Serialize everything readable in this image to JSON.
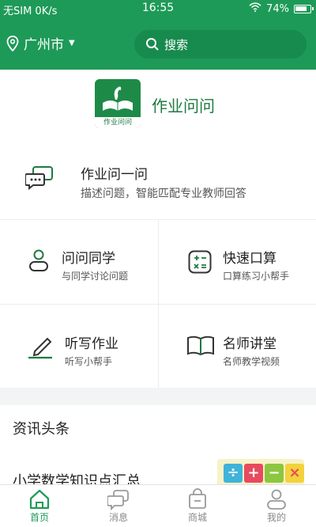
{
  "statusbar": {
    "carrier": "无SIM 0K/s",
    "time": "16:55",
    "battery": "74%"
  },
  "header": {
    "city": "广州市",
    "search_placeholder": "搜索"
  },
  "brand": {
    "name": "作业问问",
    "logo_caption": "作业问问"
  },
  "ask": {
    "title": "作业问一问",
    "subtitle": "描述问题，智能匹配专业教师回答"
  },
  "features": [
    {
      "title": "问问同学",
      "subtitle": "与同学讨论问题",
      "icon": "user-icon"
    },
    {
      "title": "快速口算",
      "subtitle": "口算练习小帮手",
      "icon": "calculator-icon"
    },
    {
      "title": "听写作业",
      "subtitle": "听写小帮手",
      "icon": "pen-icon"
    },
    {
      "title": "名师讲堂",
      "subtitle": "名师教学视频",
      "icon": "book-icon"
    }
  ],
  "news": {
    "header": "资讯头条",
    "first_title": "小学数学知识点汇总"
  },
  "tabs": [
    {
      "label": "首页",
      "icon": "home-icon",
      "active": true
    },
    {
      "label": "消息",
      "icon": "message-icon",
      "active": false
    },
    {
      "label": "商城",
      "icon": "shop-icon",
      "active": false
    },
    {
      "label": "我的",
      "icon": "profile-icon",
      "active": false
    }
  ],
  "colors": {
    "primary": "#1e9a58",
    "brand_text": "#1e7a40",
    "tab_inactive": "#888888"
  }
}
